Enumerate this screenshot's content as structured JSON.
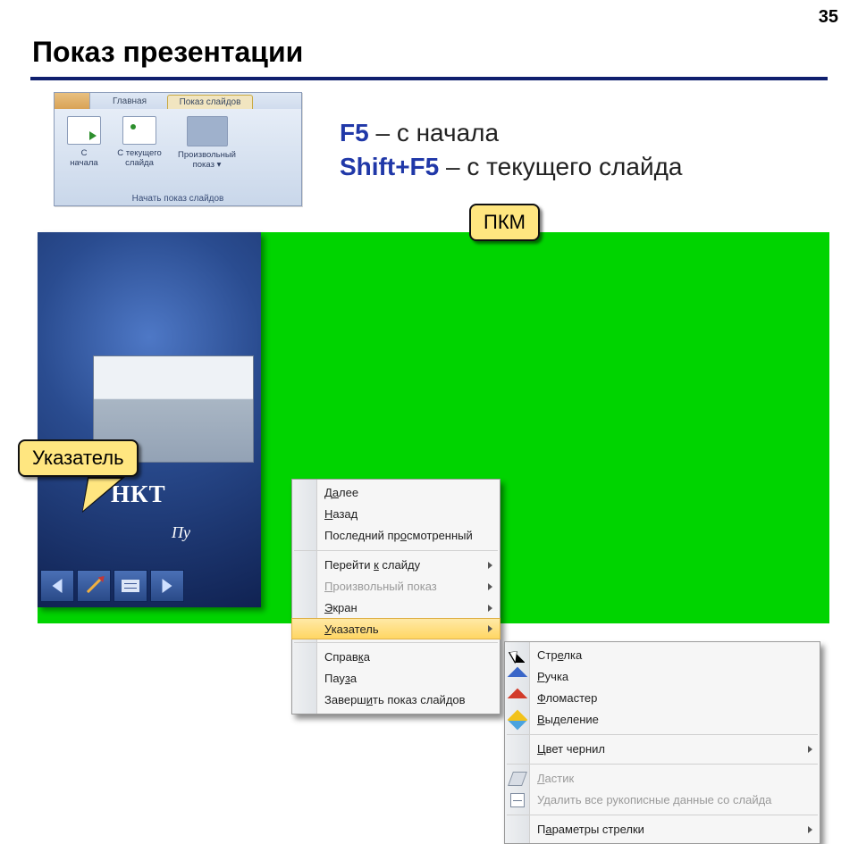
{
  "page": {
    "number": "35",
    "title": "Показ презентации"
  },
  "ribbon": {
    "tab_home": "Главная",
    "tab_show": "Показ слайдов",
    "group_label": "Начать показ слайдов",
    "btn_from_start_l1": "С",
    "btn_from_start_l2": "начала",
    "btn_from_current_l1": "С текущего",
    "btn_from_current_l2": "слайда",
    "btn_custom_l1": "Произвольный",
    "btn_custom_l2": "показ ▾"
  },
  "shortcuts": {
    "f5": "F5",
    "f5_desc": " – с начала",
    "shift_f5": "Shift+F5",
    "shift_f5_desc": " – с текущего слайда"
  },
  "callouts": {
    "pkm": "ПКМ",
    "pointer": "Указатель"
  },
  "slide": {
    "line1": "НКТ",
    "line2": "Пу"
  },
  "menu1": {
    "next": {
      "pre": "Д",
      "u": "а",
      "post": "лее"
    },
    "back": {
      "pre": "",
      "u": "Н",
      "post": "азад"
    },
    "last": {
      "pre": "Последний пр",
      "u": "о",
      "post": "смотренный"
    },
    "goto": {
      "pre": "Перейти ",
      "u": "к",
      "post": " слайду"
    },
    "custom": {
      "pre": "",
      "u": "П",
      "post": "роизвольный показ"
    },
    "screen": {
      "pre": "",
      "u": "Э",
      "post": "кран"
    },
    "pointer": {
      "pre": "",
      "u": "У",
      "post": "казатель"
    },
    "help": {
      "pre": "Справ",
      "u": "к",
      "post": "а"
    },
    "pause": {
      "pre": "Пау",
      "u": "з",
      "post": "а"
    },
    "end": {
      "pre": "Заверш",
      "u": "и",
      "post": "ть показ слайдов"
    }
  },
  "menu2": {
    "arrow": {
      "pre": "Стр",
      "u": "е",
      "post": "лка"
    },
    "pen": {
      "pre": "",
      "u": "Р",
      "post": "учка"
    },
    "marker": {
      "pre": "",
      "u": "Ф",
      "post": "ломастер"
    },
    "highlight": {
      "pre": "",
      "u": "В",
      "post": "ыделение"
    },
    "inkcolor": {
      "pre": "",
      "u": "Ц",
      "post": "вет чернил"
    },
    "eraser": {
      "pre": "",
      "u": "Л",
      "post": "астик"
    },
    "eraseall": {
      "text": "Удалить все рукописные данные со слайда"
    },
    "arrowopt": {
      "pre": "П",
      "u": "а",
      "post": "раметры стрелки"
    }
  }
}
